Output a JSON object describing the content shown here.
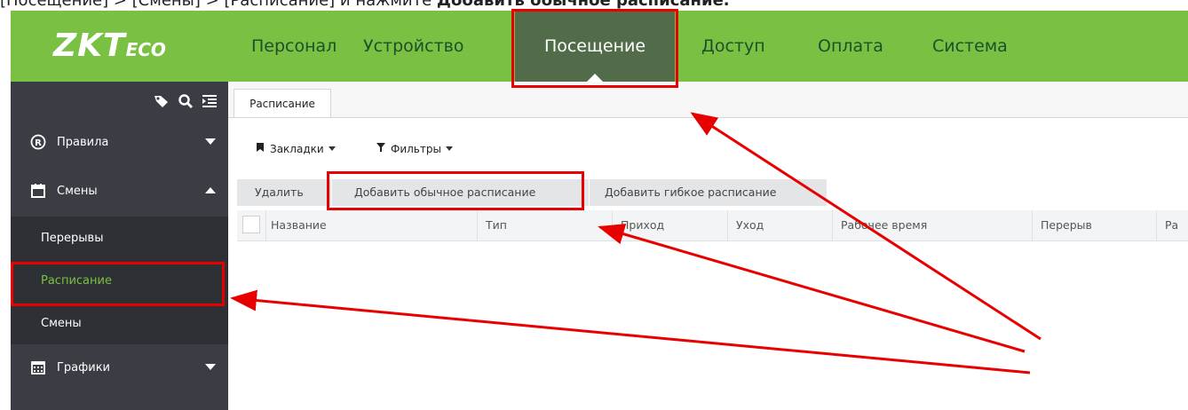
{
  "caption": {
    "part1": "[Посещение] > [Смены] > [Расписание] и нажмите ",
    "part2": "Добавить обычное расписание."
  },
  "header": {
    "logo_main": "ZKT",
    "logo_eco": "ECO",
    "nav": [
      {
        "label": "Персонал"
      },
      {
        "label": "Устройство"
      },
      {
        "label": "Посещение",
        "active": true
      },
      {
        "label": "Доступ"
      },
      {
        "label": "Оплата"
      },
      {
        "label": "Система"
      }
    ]
  },
  "sidebar": {
    "tools": [
      "tags-icon",
      "search-icon",
      "list-toggle-icon"
    ],
    "items": [
      {
        "label": "Правила",
        "icon": "registered-icon",
        "expanded": false
      },
      {
        "label": "Смены",
        "icon": "calendar-icon",
        "expanded": true
      },
      {
        "label": "Перерывы",
        "sub": true
      },
      {
        "label": "Расписание",
        "sub": true,
        "selected": true
      },
      {
        "label": "Смены",
        "sub": true
      },
      {
        "label": "Графики",
        "icon": "calendar-grid-icon",
        "expanded": false
      }
    ]
  },
  "content": {
    "tab_label": "Расписание",
    "toolbar": {
      "bookmarks_label": "Закладки",
      "filters_label": "Фильтры"
    },
    "actions": {
      "delete_label": "Удалить",
      "add_normal_label": "Добавить обычное расписание",
      "add_flexible_label": "Добавить гибкое расписание"
    },
    "columns": [
      "Название",
      "Тип",
      "Приход",
      "Уход",
      "Рабочее время",
      "Перерыв",
      "Ра"
    ]
  },
  "colors": {
    "topbar": "#7ac143",
    "active_nav": "#526c4a",
    "sidebar": "#3a3e44",
    "sidebar_sub": "#2d3035",
    "selected_text": "#7ac143",
    "annotation": "#e80000"
  }
}
